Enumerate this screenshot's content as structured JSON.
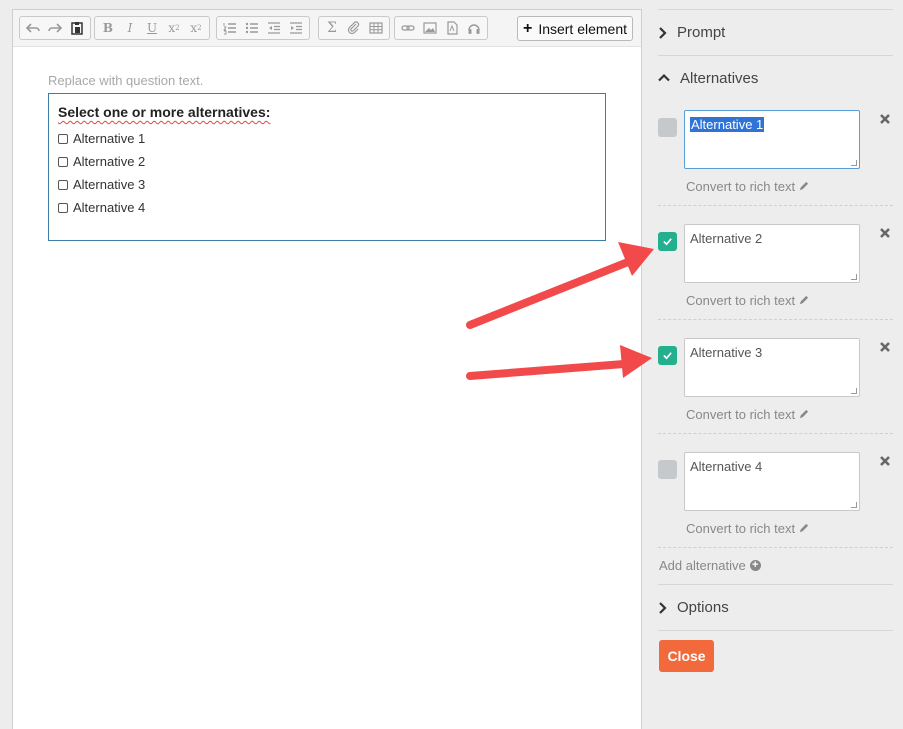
{
  "toolbar": {
    "insert_label": "Insert element",
    "buttons": [
      "undo-icon",
      "redo-icon",
      "paste-icon",
      "bold",
      "italic",
      "underline",
      "subscript",
      "superscript",
      "numbered-list-icon",
      "bullet-list-icon",
      "outdent-icon",
      "indent-icon",
      "sigma-icon",
      "attachment-icon",
      "table-icon",
      "link-icon",
      "image-icon",
      "pdf-icon",
      "audio-icon"
    ],
    "bold_glyph": "B",
    "italic_glyph": "I",
    "underline_glyph": "U",
    "sub_glyph": "x",
    "sup_glyph": "x",
    "sigma_glyph": "Σ"
  },
  "editor": {
    "placeholder": "Replace with question text.",
    "prompt": "Select one or more alternatives:",
    "options": [
      "Alternative 1",
      "Alternative 2",
      "Alternative 3",
      "Alternative 4"
    ]
  },
  "panel": {
    "prompt_section": "Prompt",
    "alternatives_section": "Alternatives",
    "options_section": "Options",
    "convert_label": "Convert to rich text",
    "add_alternative": "Add alternative",
    "close_label": "Close",
    "alternatives": [
      {
        "text": "Alternative 1",
        "checked": false,
        "selected": true
      },
      {
        "text": "Alternative 2",
        "checked": true,
        "selected": false
      },
      {
        "text": "Alternative 3",
        "checked": true,
        "selected": false
      },
      {
        "text": "Alternative 4",
        "checked": false,
        "selected": false
      }
    ]
  },
  "colors": {
    "check_on": "#24b08e",
    "check_off": "#c6c9cc",
    "close_button": "#f26a3b",
    "annotation_arrow": "#f24a4a",
    "selection": "#2f73d6"
  }
}
